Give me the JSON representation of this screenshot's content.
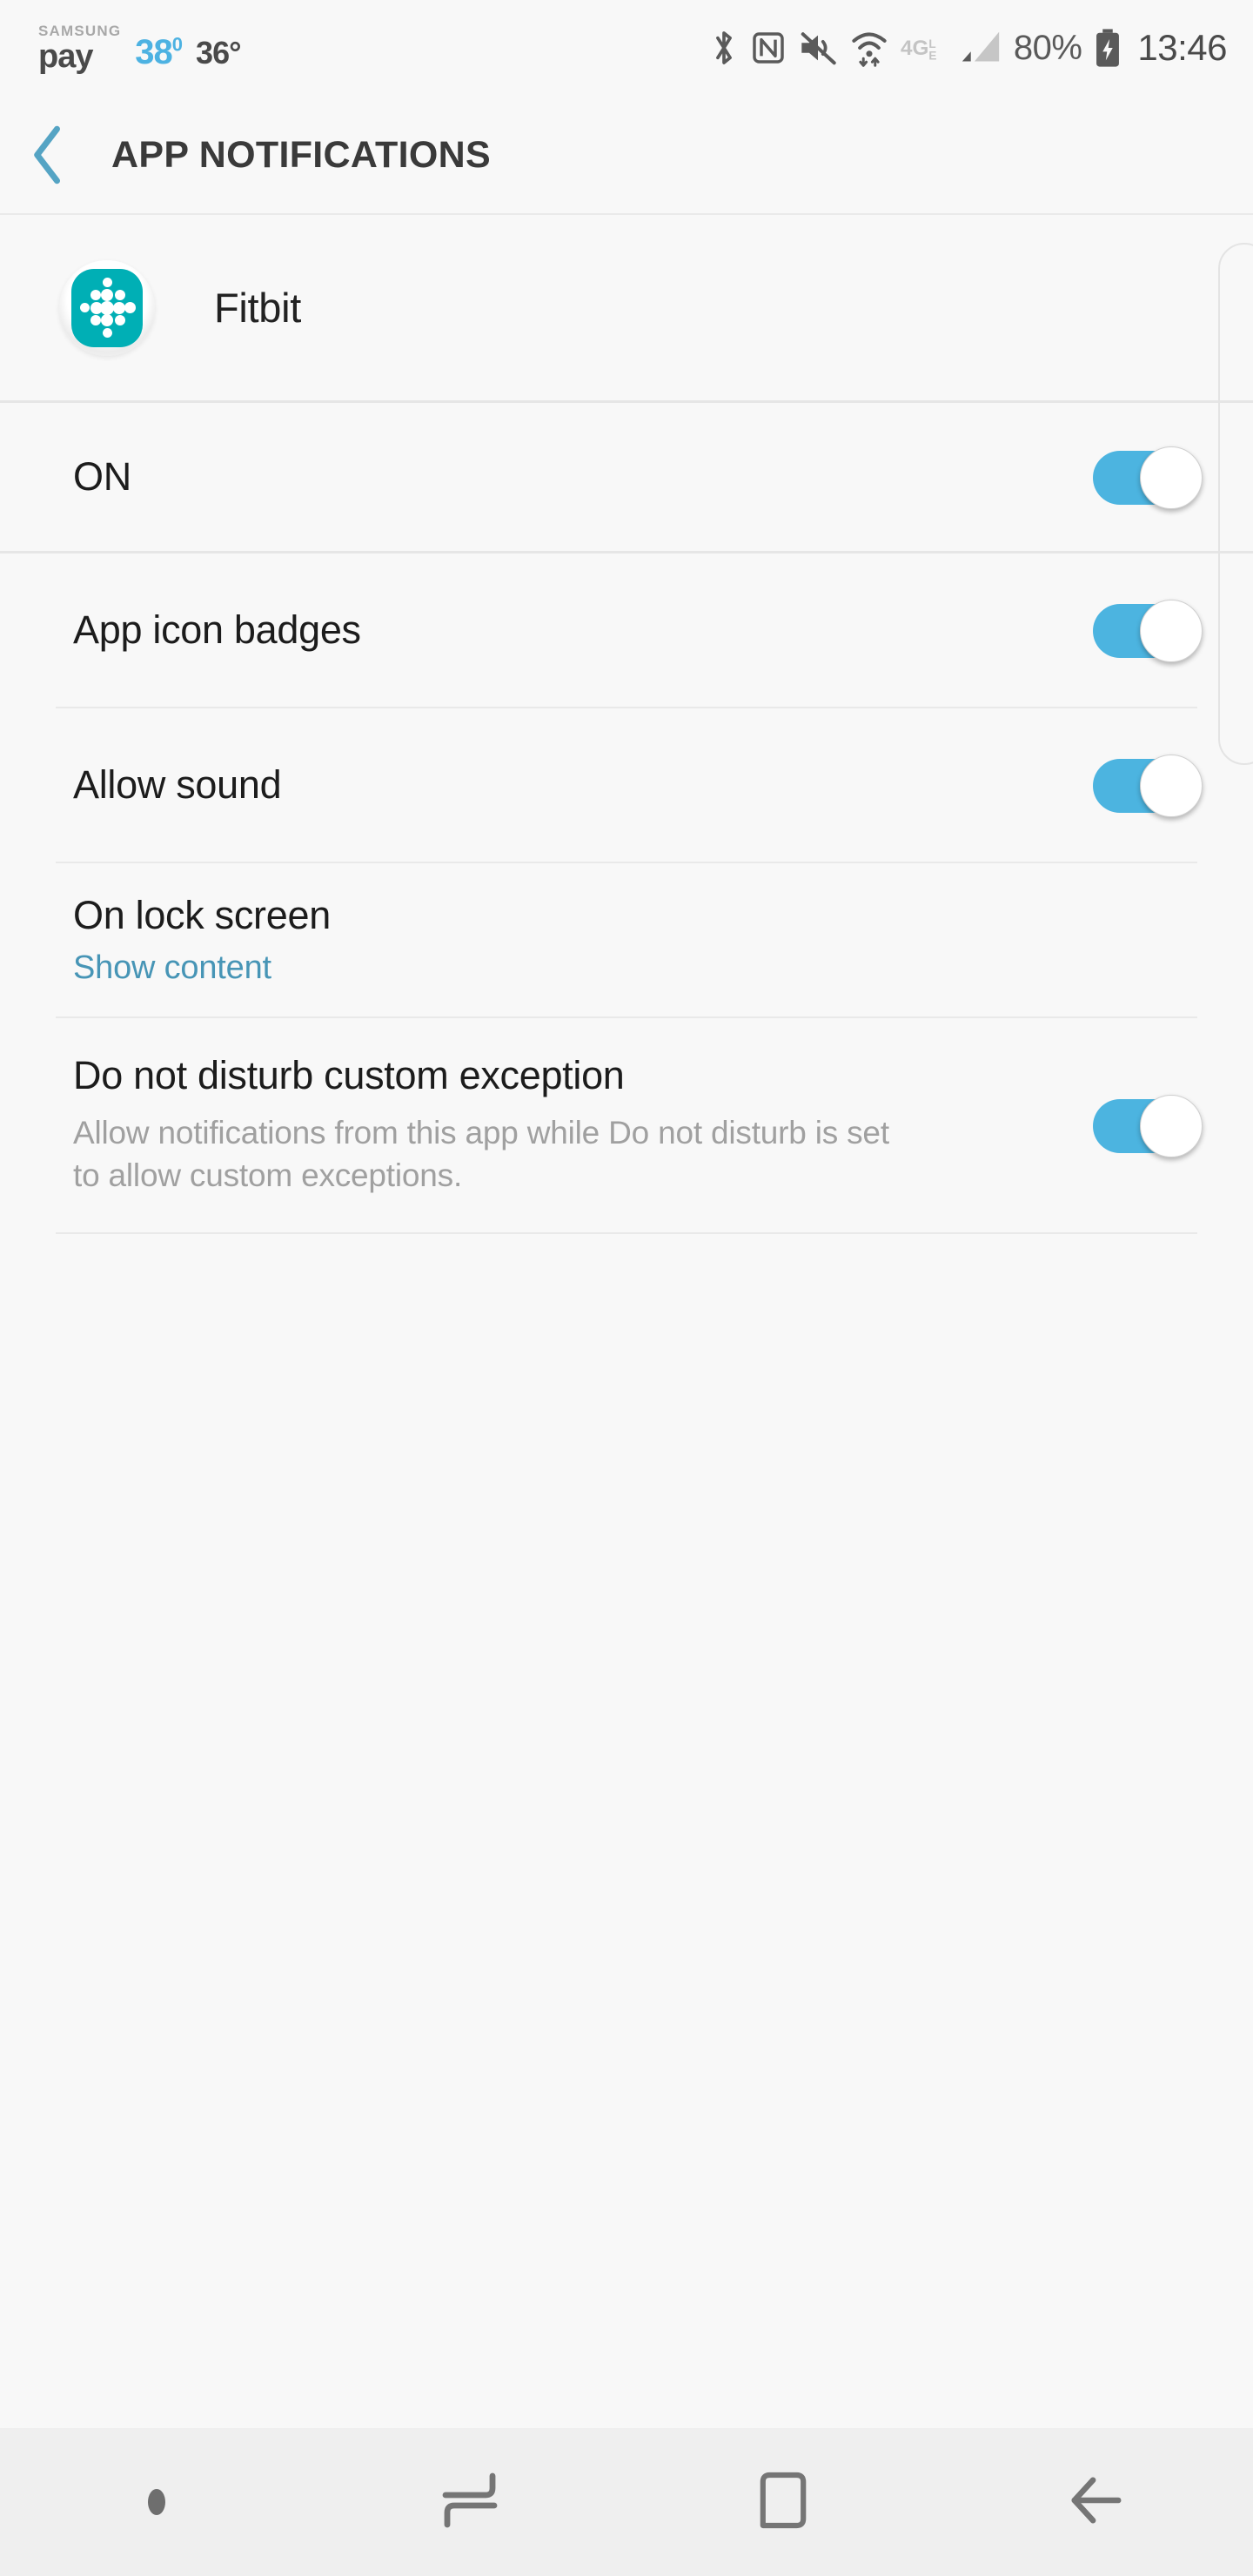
{
  "status_bar": {
    "samsung_pay_top": "SAMSUNG",
    "samsung_pay_bottom": "pay",
    "temp_primary": "38",
    "temp_primary_degree": "0",
    "temp_secondary": "36°",
    "battery_percent": "80%",
    "clock": "13:46",
    "icons": [
      "bluetooth-icon",
      "nfc-icon",
      "volume-mute-icon",
      "wifi-icon",
      "4glte-icon",
      "cell-signal-icon",
      "battery-charging-icon"
    ]
  },
  "app_bar": {
    "back_icon": "back-chevron-icon",
    "title": "APP NOTIFICATIONS"
  },
  "app_header": {
    "icon_name": "fitbit-app-icon",
    "app_name": "Fitbit"
  },
  "settings": [
    {
      "id": "master-on",
      "title": "ON",
      "subtitle": null,
      "subtitle_style": null,
      "control": "toggle",
      "toggle_on": true
    },
    {
      "id": "app-icon-badges",
      "title": "App icon badges",
      "subtitle": null,
      "subtitle_style": null,
      "control": "toggle",
      "toggle_on": true
    },
    {
      "id": "allow-sound",
      "title": "Allow sound",
      "subtitle": null,
      "subtitle_style": null,
      "control": "toggle",
      "toggle_on": true
    },
    {
      "id": "on-lock-screen",
      "title": "On lock screen",
      "subtitle": "Show content",
      "subtitle_style": "link",
      "control": "none",
      "toggle_on": null
    },
    {
      "id": "dnd-custom-exception",
      "title": "Do not disturb custom exception",
      "subtitle": "Allow notifications from this app while Do not disturb is set to allow custom exceptions.",
      "subtitle_style": "muted",
      "control": "toggle",
      "toggle_on": true
    }
  ],
  "nav_bar": {
    "items": [
      {
        "id": "nav-indicator-dot",
        "icon": "dot-indicator-icon"
      },
      {
        "id": "nav-recents",
        "icon": "recents-icon"
      },
      {
        "id": "nav-home",
        "icon": "home-icon"
      },
      {
        "id": "nav-back",
        "icon": "back-arrow-icon"
      }
    ]
  },
  "colors": {
    "accent_blue": "#4cb4e0",
    "link_blue": "#4795b6",
    "fitbit_teal": "#00afb5",
    "background": "#f8f8f8",
    "navbar_bg": "#efefef"
  }
}
